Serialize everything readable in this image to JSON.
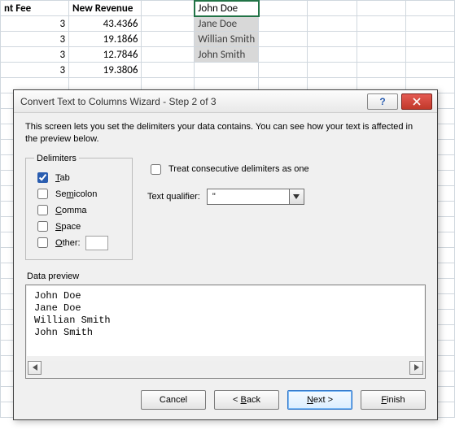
{
  "sheet": {
    "headers": [
      "nt Fee",
      "New Revenue"
    ],
    "rows": [
      {
        "fee": "3",
        "rev": "43.4366",
        "name": "John Doe"
      },
      {
        "fee": "3",
        "rev": "19.1866",
        "name": "Jane Doe"
      },
      {
        "fee": "3",
        "rev": "12.7846",
        "name": "Willian Smith"
      },
      {
        "fee": "3",
        "rev": "19.3806",
        "name": "John Smith"
      }
    ]
  },
  "dialog": {
    "title": "Convert Text to Columns Wizard - Step 2 of 3",
    "description": "This screen lets you set the delimiters your data contains.  You can see how your text is affected in the preview below.",
    "delimiters_legend": "Delimiters",
    "delim": {
      "tab": "Tab",
      "semicolon": "Semicolon",
      "comma": "Comma",
      "space": "Space",
      "other": "Other:"
    },
    "treat_consecutive": "Treat consecutive delimiters as one",
    "text_qualifier_label": "Text qualifier:",
    "text_qualifier_value": "\"",
    "preview_label": "Data preview",
    "preview_lines": [
      "John Doe",
      "Jane Doe",
      "Willian Smith",
      "John Smith"
    ],
    "buttons": {
      "cancel": "Cancel",
      "back": "< Back",
      "next": "Next >",
      "finish": "Finish"
    }
  }
}
